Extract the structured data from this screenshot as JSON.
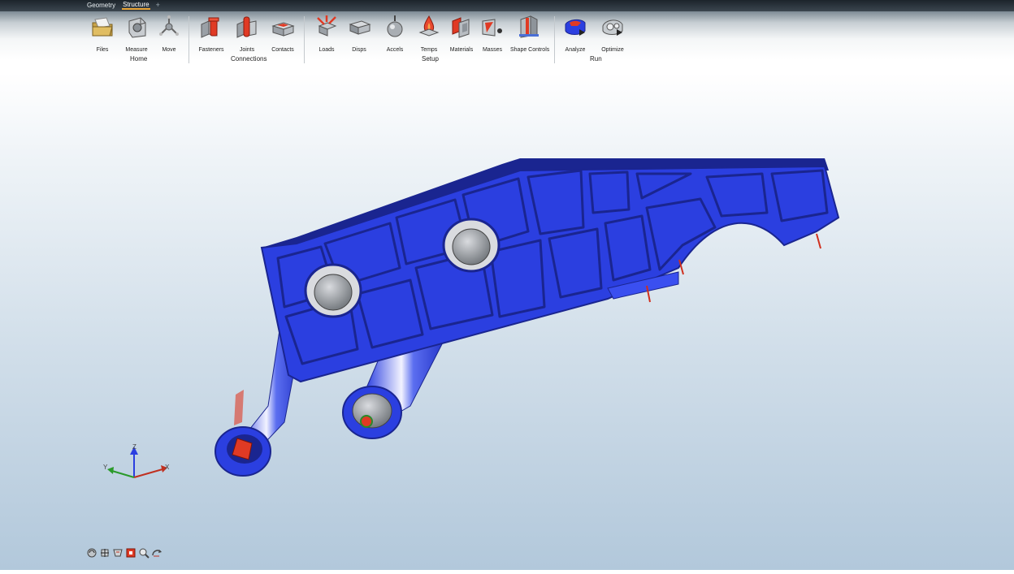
{
  "tabs": [
    {
      "label": "Geometry",
      "active": false
    },
    {
      "label": "Structure",
      "active": true
    }
  ],
  "tab_add_label": "+",
  "ribbon": {
    "groups": [
      {
        "name": "Home",
        "tools": [
          {
            "label": "Files",
            "icon": "folder-icon"
          },
          {
            "label": "Measure",
            "icon": "measure-icon"
          },
          {
            "label": "Move",
            "icon": "move-icon"
          }
        ]
      },
      {
        "name": "Connections",
        "tools": [
          {
            "label": "Fasteners",
            "icon": "fastener-icon"
          },
          {
            "label": "Joints",
            "icon": "joint-icon"
          },
          {
            "label": "Contacts",
            "icon": "contact-icon"
          }
        ]
      },
      {
        "name": "Setup",
        "tools": [
          {
            "label": "Loads",
            "icon": "load-icon"
          },
          {
            "label": "Disps",
            "icon": "displacement-icon"
          },
          {
            "label": "Accels",
            "icon": "acceleration-icon"
          },
          {
            "label": "Temps",
            "icon": "temperature-icon"
          },
          {
            "label": "Materials",
            "icon": "materials-icon"
          },
          {
            "label": "Masses",
            "icon": "mass-icon"
          },
          {
            "label": "Shape Controls",
            "icon": "shape-controls-icon"
          }
        ]
      },
      {
        "name": "Run",
        "tools": [
          {
            "label": "Analyze",
            "icon": "analyze-icon"
          },
          {
            "label": "Optimize",
            "icon": "optimize-icon"
          }
        ]
      }
    ]
  },
  "triad": {
    "z": "Z",
    "x": "X",
    "y": "Y"
  },
  "colors": {
    "model_blue": "#2b3fe0",
    "model_dark": "#1a2590",
    "hot_red": "#e03020",
    "accent_orange": "#e8a436"
  },
  "view_tools": [
    "view-rotate-icon",
    "view-pan-icon",
    "view-zoom-icon",
    "view-fit-icon",
    "view-magnify-icon",
    "view-reset-icon"
  ]
}
